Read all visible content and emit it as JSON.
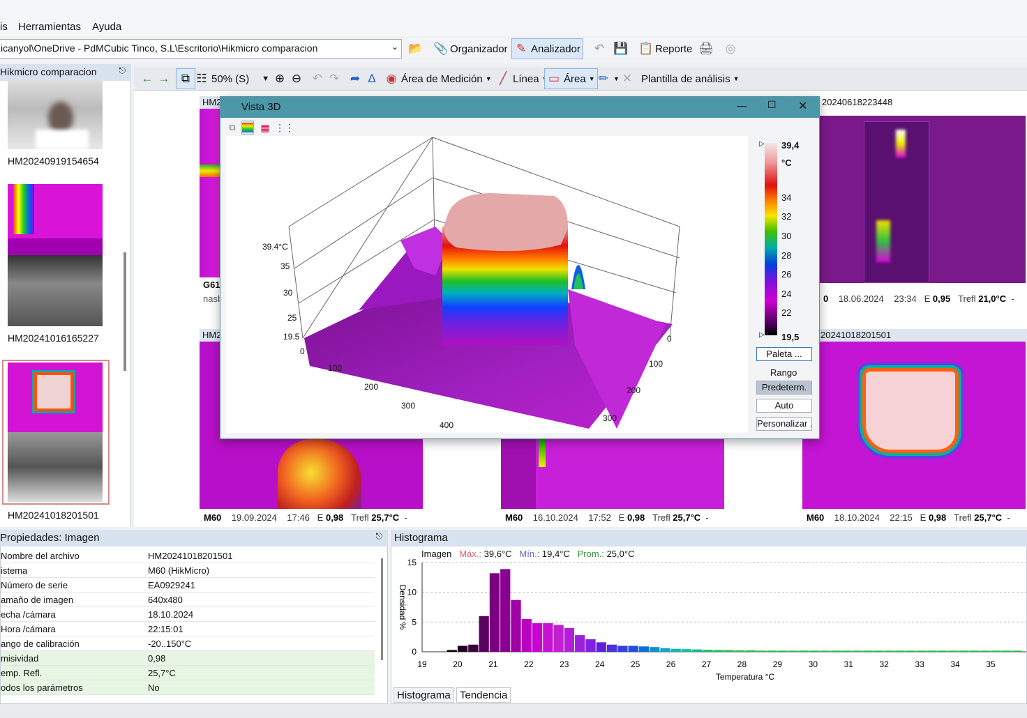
{
  "menu": {
    "items": [
      "is",
      "Herramientas",
      "Ayuda"
    ]
  },
  "pathbar": {
    "path": "icanyol\\OneDrive - PdMCubic Tinco, S.L\\Escritorio\\Hikmicro comparacion",
    "organizer": "Organizador",
    "analyzer": "Analizador",
    "report": "Reporte"
  },
  "left_panel": {
    "title": "Hikmicro comparacion",
    "thumbs": [
      "HM20240919154654",
      "HM20241016165227",
      "HM20241018201501"
    ]
  },
  "viewer_toolbar": {
    "zoom": "50% (S)",
    "measure_area": "Área de Medición",
    "line": "Línea",
    "area": "Área",
    "template": "Plantilla de análisis"
  },
  "images": {
    "top_left_header": "HM2",
    "top_left_foot1": "G61",
    "top_left_foot2": "nasb",
    "top_right_header": "20240618223448",
    "top_right_footer": {
      "device": "0",
      "date": "18.06.2024",
      "time": "23:34",
      "e_label": "E",
      "e": "0,95",
      "t_label": "Trefl",
      "t": "21,0°C",
      "dash": "-"
    },
    "bottom_left_header": "HM2",
    "bottom_right_header": "20241018201501",
    "bottom_left_footer": {
      "device": "M60",
      "date": "19.09.2024",
      "time": "17:46",
      "e_label": "E",
      "e": "0,98",
      "t_label": "Trefl",
      "t": "25,7°C",
      "dash": "-"
    },
    "bottom_mid_footer": {
      "device": "M60",
      "date": "16.10.2024",
      "time": "17:52",
      "e_label": "E",
      "e": "0,98",
      "t_label": "Trefl",
      "t": "25,7°C",
      "dash": "-"
    },
    "bottom_right_footer": {
      "device": "M60",
      "date": "18.10.2024",
      "time": "22:15",
      "e_label": "E",
      "e": "0,98",
      "t_label": "Trefl",
      "t": "25,7°C",
      "dash": "-"
    }
  },
  "dialog": {
    "title": "Vista 3D",
    "z_ticks": [
      "39.4°C",
      "35",
      "30",
      "25",
      "19.5"
    ],
    "x_ticks": [
      "0",
      "100",
      "200",
      "300",
      "400"
    ],
    "y_ticks": [
      "0",
      "100",
      "200",
      "300"
    ],
    "cb_max": "39,4",
    "cb_unit": "°C",
    "cb_ticks": [
      "34",
      "32",
      "30",
      "28",
      "26",
      "24",
      "22"
    ],
    "cb_min": "19,5",
    "palette_btn": "Paleta ...",
    "range_label": "Rango",
    "predet_btn": "Predeterm.",
    "auto_btn": "Auto",
    "custom_btn": "Personalizar ..."
  },
  "properties": {
    "title": "Propiedades: Imagen",
    "rows": [
      {
        "k": "Nombre del archivo",
        "v": "HM20241018201501"
      },
      {
        "k": "istema",
        "v": "M60 (HikMicro)"
      },
      {
        "k": "Número de serie",
        "v": "EA0929241"
      },
      {
        "k": "amaño de imagen",
        "v": "640x480"
      },
      {
        "k": "echa /cámara",
        "v": "18.10.2024"
      },
      {
        "k": "Hora /cámara",
        "v": "22:15:01"
      },
      {
        "k": "ango de calibración",
        "v": "-20..150°C"
      },
      {
        "k": "misividad",
        "v": "0,98"
      },
      {
        "k": "emp. Refl.",
        "v": "25,7°C"
      },
      {
        "k": "odos los parámetros",
        "v": "No"
      }
    ]
  },
  "histogram": {
    "title": "Histograma",
    "legend_image": "Imagen",
    "max_label": "Máx.:",
    "max_val": "39,6°C",
    "min_label": "Mín.:",
    "min_val": "19,4°C",
    "avg_label": "Prom.:",
    "avg_val": "25,0°C",
    "tab_hist": "Histograma",
    "tab_trend": "Tendencia"
  },
  "chart_data": {
    "type": "bar",
    "ylabel": "Densidad %",
    "xlabel": "Temperatura °C",
    "xlim": [
      19,
      36
    ],
    "ylim": [
      0,
      15
    ],
    "y_ticks": [
      0,
      5,
      10,
      15
    ],
    "x_ticks": [
      19,
      20,
      21,
      22,
      23,
      24,
      25,
      26,
      27,
      28,
      29,
      30,
      31,
      32,
      33,
      34,
      35
    ],
    "bin_width": 0.3,
    "bins_start": [
      19.7,
      20.0,
      20.3,
      20.6,
      20.9,
      21.2,
      21.5,
      21.8,
      22.1,
      22.4,
      22.7,
      23.0,
      23.3,
      23.6,
      23.9,
      24.2,
      24.5,
      24.8,
      25.1,
      25.4,
      25.7,
      26.0,
      26.3,
      26.6,
      26.9,
      27.2,
      27.5,
      27.8,
      28.1,
      28.4,
      28.7,
      29.0,
      29.3,
      29.6,
      29.9,
      30.2,
      30.5,
      30.8,
      31.1,
      31.4,
      31.7,
      32.0,
      32.3,
      32.6,
      32.9,
      33.2,
      33.5,
      33.8,
      34.1,
      34.4,
      34.7,
      35.0,
      35.3,
      35.6
    ],
    "values": [
      0.3,
      1.0,
      1.2,
      6.0,
      13.2,
      13.9,
      8.7,
      5.5,
      4.8,
      4.8,
      4.5,
      4.0,
      2.8,
      2.1,
      1.6,
      1.2,
      1.0,
      1.0,
      0.9,
      0.8,
      0.6,
      0.5,
      0.45,
      0.4,
      0.35,
      0.3,
      0.3,
      0.25,
      0.25,
      0.2,
      0.2,
      0.2,
      0.2,
      0.2,
      0.2,
      0.2,
      0.2,
      0.2,
      0.2,
      0.2,
      0.2,
      0.2,
      0.2,
      0.2,
      0.2,
      0.2,
      0.2,
      0.2,
      0.2,
      0.2,
      0.2,
      0.2,
      0.2,
      0.2
    ]
  }
}
